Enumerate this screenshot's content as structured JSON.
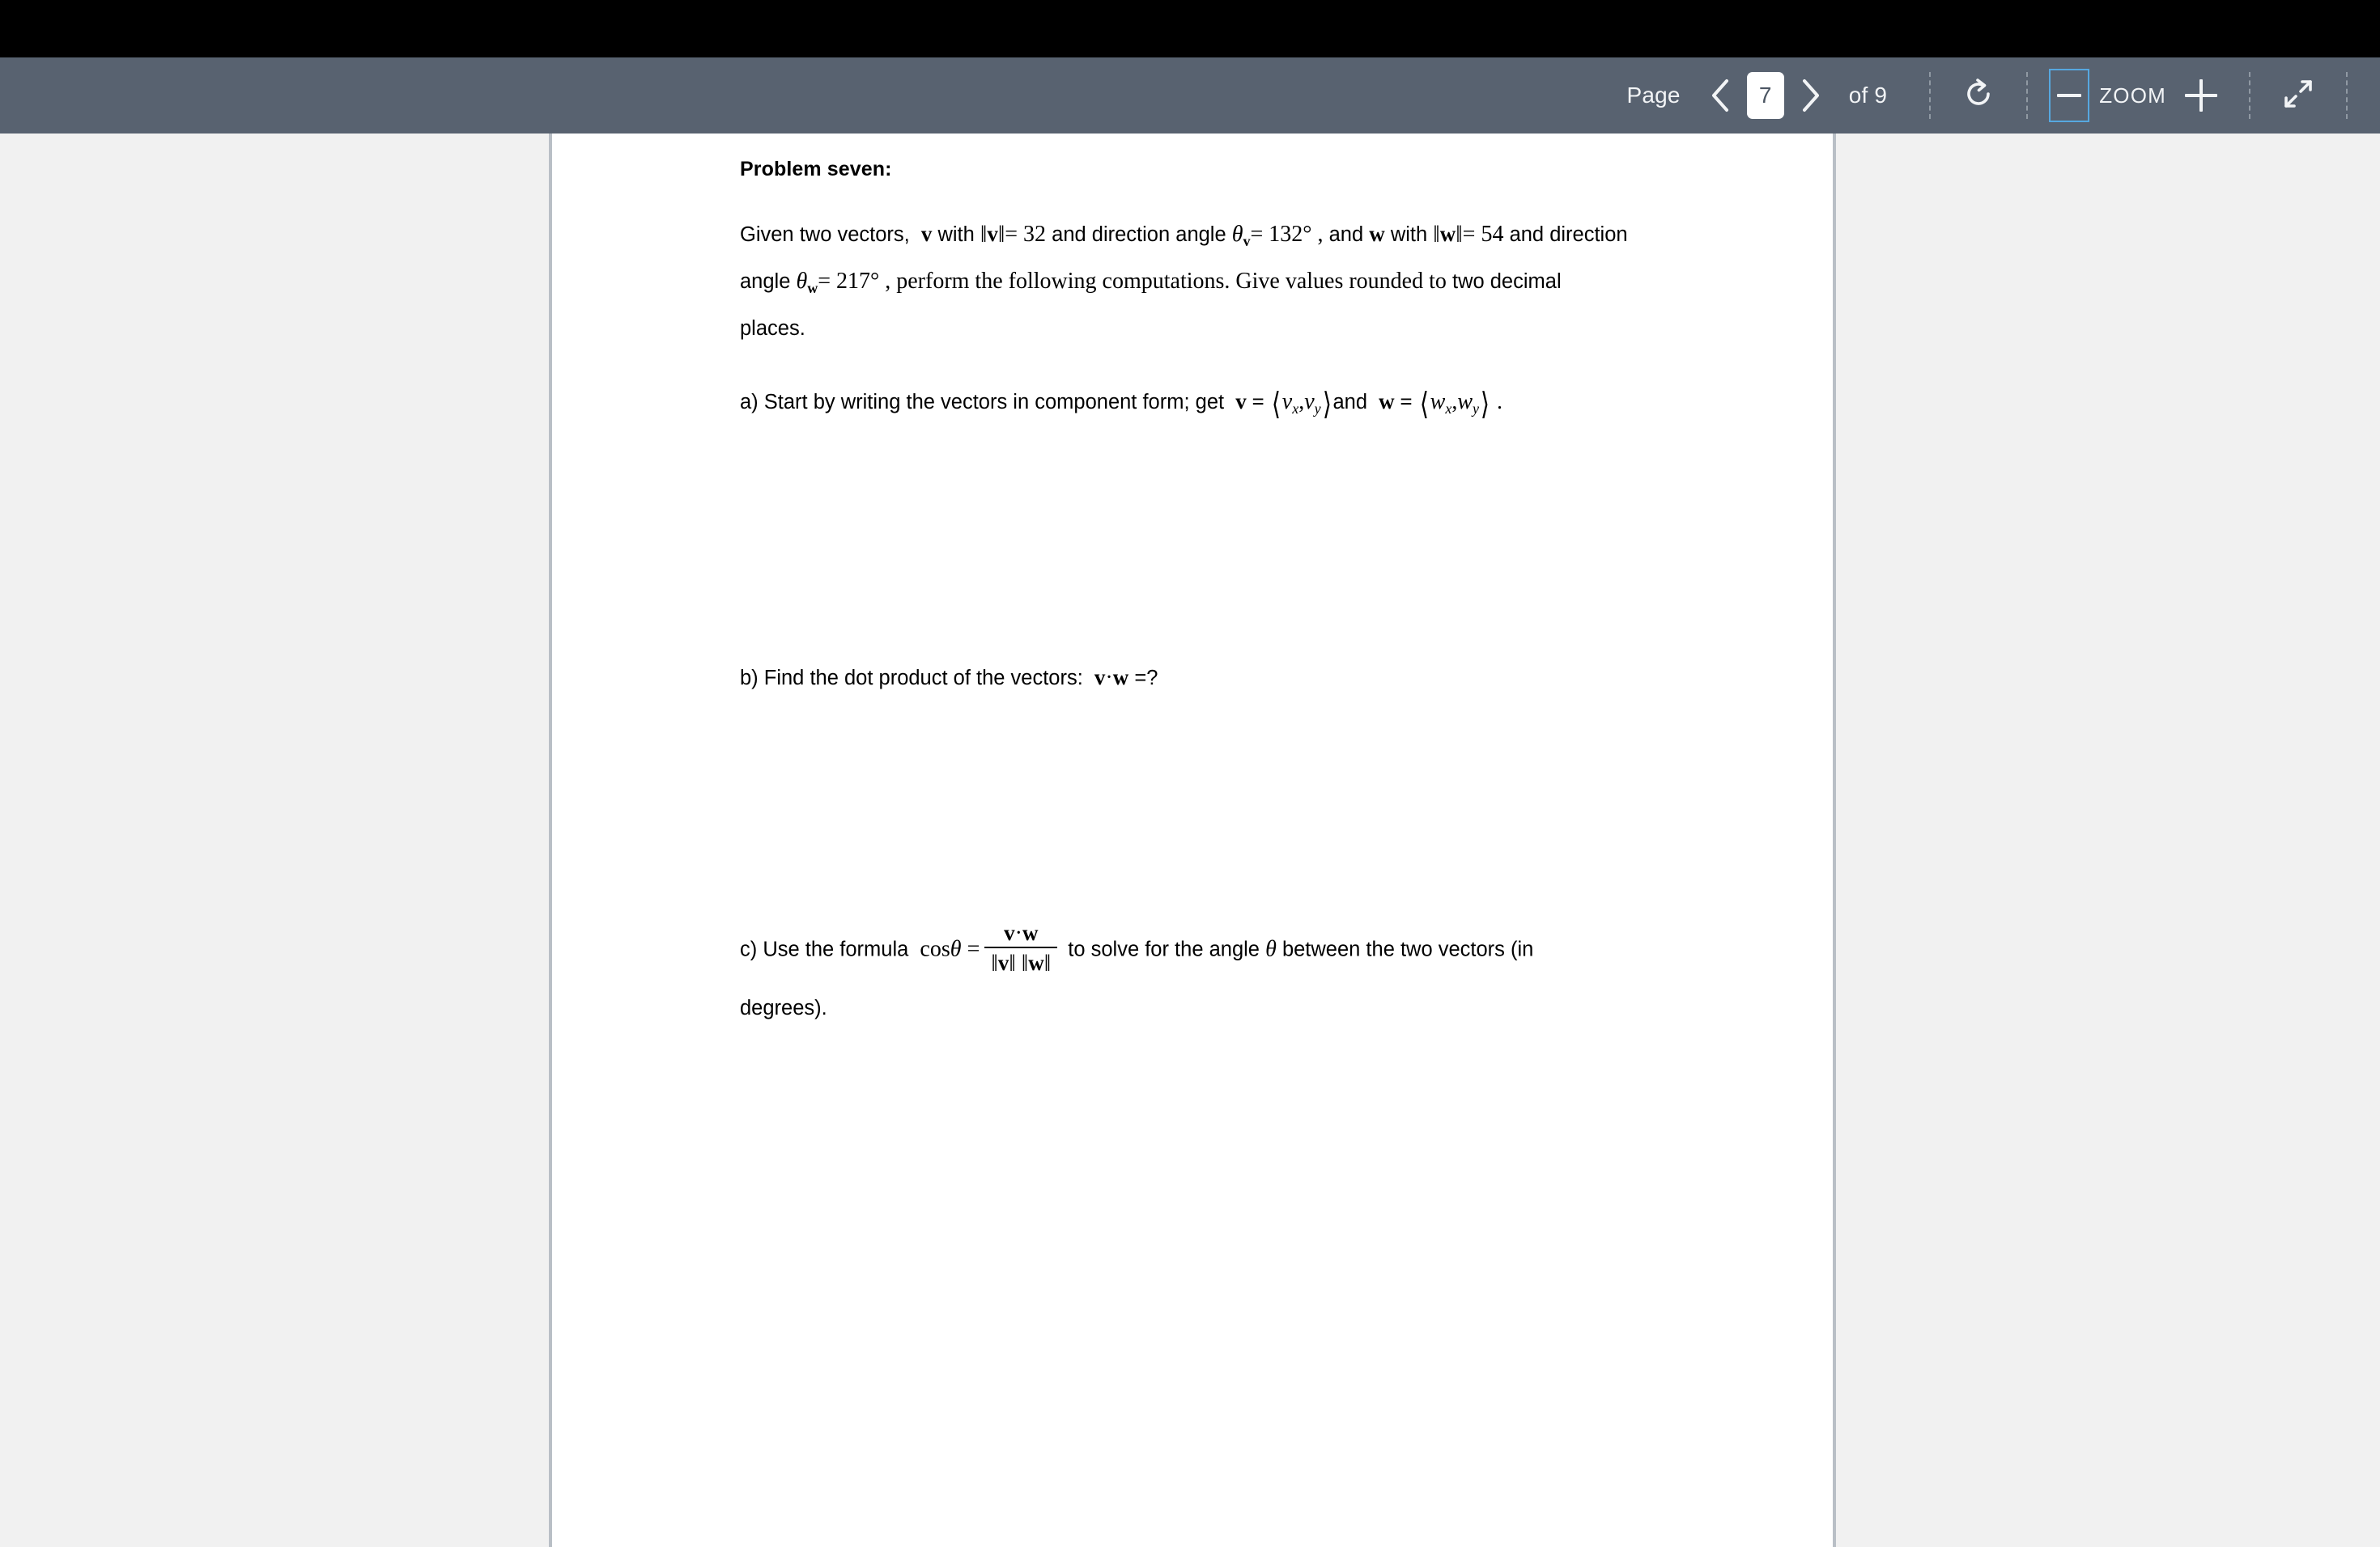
{
  "toolbar": {
    "page_label": "Page",
    "page_value": "7",
    "of_label": "of 9",
    "zoom_label": "ZOOM",
    "prev_icon": "chevron-left-icon",
    "next_icon": "chevron-right-icon",
    "rotate_icon": "rotate-icon",
    "zoom_out_icon": "minus-icon",
    "zoom_in_icon": "plus-icon",
    "fullscreen_icon": "exit-fullscreen-icon",
    "accent_focus_color": "#56a8e0",
    "bar_color": "#586270"
  },
  "document": {
    "title": "Problem seven:",
    "intro": {
      "line1_a": "Given two vectors,",
      "v_bold": "v",
      "line1_b": "with",
      "norm_open": "‖",
      "norm_close": "‖",
      "eq32": "= 32",
      "line1_c": "and direction angle",
      "theta": "θ",
      "sub_v": "v",
      "eq132": "= 132° ,",
      "line1_d": "and",
      "w_bold": "w",
      "line1_e": "with",
      "eq54": "= 54",
      "line2_a": "and direction angle",
      "sub_w": "w",
      "eq217": "= 217° , perform the following computations. Give values rounded to",
      "line3": "two decimal places."
    },
    "parts": [
      {
        "id": "a",
        "text_before": "a) Start by writing the vectors in component form; get",
        "v_eq": "v =",
        "v_components": "v",
        "sub_x": "x",
        "sub_y": "y",
        "and_word": "and",
        "w_eq": "w =",
        "w_components": "w",
        "period": "."
      },
      {
        "id": "b",
        "text": "b) Find the dot product of the vectors:",
        "expr_v": "v",
        "dot": "·",
        "expr_w": "w",
        "eq_q": "=?"
      },
      {
        "id": "c",
        "text_before": "c) Use the formula",
        "cos": "cos",
        "theta": "θ",
        "equals": "=",
        "numerator_v": "v",
        "numerator_dot": "·",
        "numerator_w": "w",
        "text_mid": "to solve for the angle",
        "text_after": "between the two vectors (in",
        "text_last": "degrees)."
      }
    ]
  }
}
